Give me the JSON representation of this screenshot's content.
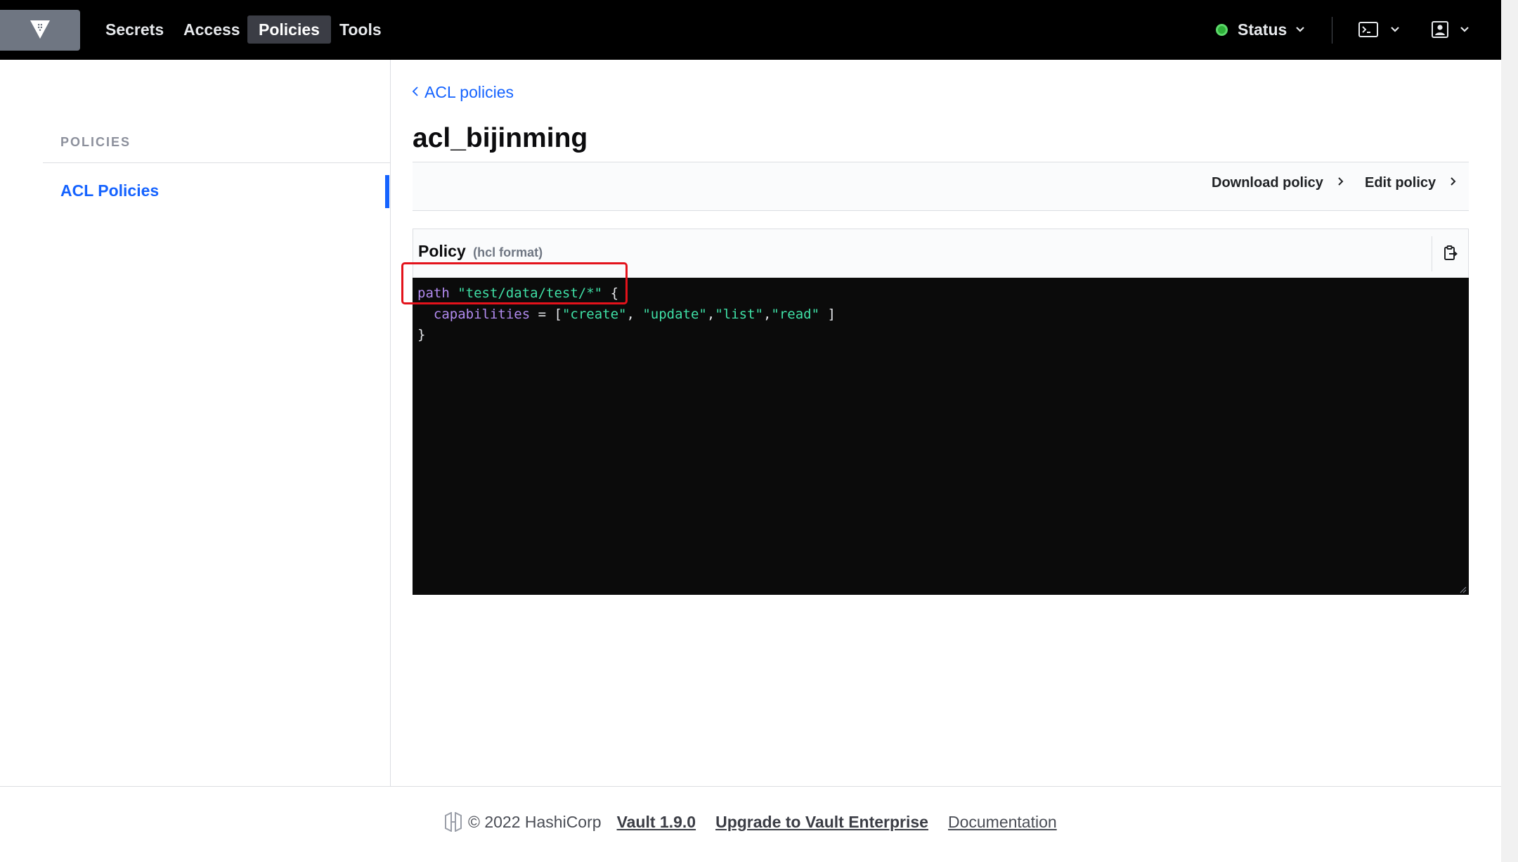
{
  "nav": {
    "links": [
      "Secrets",
      "Access",
      "Policies",
      "Tools"
    ],
    "active": "Policies",
    "status_label": "Status",
    "status_color": "#2eb039"
  },
  "sidebar": {
    "heading": "POLICIES",
    "items": [
      {
        "label": "ACL Policies",
        "active": true
      }
    ]
  },
  "main": {
    "breadcrumb": "ACL policies",
    "title": "acl_bijinming",
    "actions": {
      "download": "Download policy",
      "edit": "Edit policy"
    },
    "panel": {
      "title": "Policy",
      "subtitle": "(hcl format)",
      "code": {
        "line1_kw": "path",
        "line1_str": "\"test/data/test/*\"",
        "line1_tail": " {",
        "line2_indent": "  ",
        "line2_kw": "capabilities",
        "line2_op": " = [",
        "line2_v1": "\"create\"",
        "line2_sep1": ", ",
        "line2_v2": "\"update\"",
        "line2_sep2": ",",
        "line2_v3": "\"list\"",
        "line2_sep3": ",",
        "line2_v4": "\"read\"",
        "line2_tail": " ]",
        "line3": "}"
      }
    }
  },
  "footer": {
    "copyright": "© 2022 HashiCorp",
    "version_link": "Vault 1.9.0",
    "upgrade_link": "Upgrade to Vault Enterprise",
    "docs_link": "Documentation"
  },
  "icons": {
    "logo": "vault-logo-icon",
    "status": "status-dot-icon",
    "console": "terminal-icon",
    "user": "user-icon",
    "copy": "clipboard-copy-icon",
    "back": "chevron-left-icon",
    "hashicorp": "hashicorp-logo-icon"
  },
  "colors": {
    "accent": "#1563ff",
    "nav_bg": "#000000",
    "code_bg": "#0b0b0b",
    "highlight": "#e3121b"
  }
}
